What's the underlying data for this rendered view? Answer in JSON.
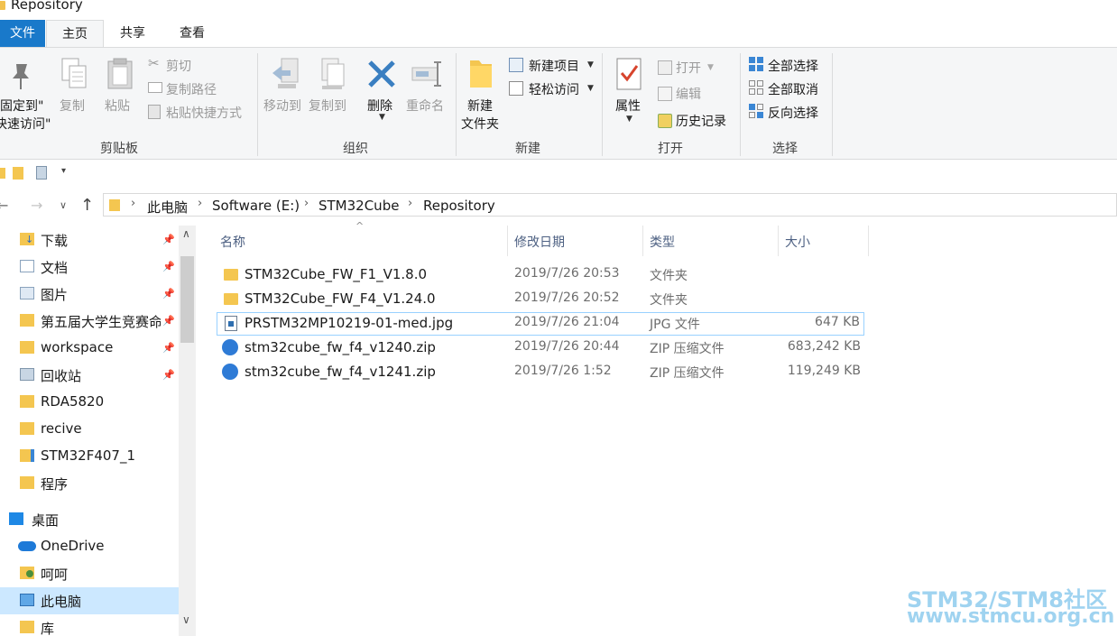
{
  "window": {
    "title": "Repository"
  },
  "ribbon_tabs": [
    "文件",
    "主页",
    "共享",
    "查看"
  ],
  "ribbon": {
    "clipboard": {
      "pin_line1": "固定到\"",
      "pin_line2": "快速访问\"",
      "copy": "复制",
      "paste": "粘贴",
      "cut": "剪切",
      "copy_path": "复制路径",
      "paste_shortcut": "粘贴快捷方式",
      "label": "剪贴板"
    },
    "organize": {
      "move_to": "移动到",
      "copy_to": "复制到",
      "delete": "删除",
      "rename": "重命名",
      "label": "组织"
    },
    "new": {
      "new_folder_line1": "新建",
      "new_folder_line2": "文件夹",
      "new_item": "新建项目",
      "easy_access": "轻松访问",
      "label": "新建"
    },
    "open": {
      "properties": "属性",
      "open": "打开",
      "edit": "编辑",
      "history": "历史记录",
      "label": "打开"
    },
    "select": {
      "select_all": "全部选择",
      "select_none": "全部取消",
      "invert": "反向选择",
      "label": "选择"
    }
  },
  "address": {
    "crumbs": [
      "此电脑",
      "Software (E:)",
      "STM32Cube",
      "Repository"
    ]
  },
  "sidebar": {
    "items": [
      {
        "label": "下载",
        "pinned": true
      },
      {
        "label": "文档",
        "pinned": true
      },
      {
        "label": "图片",
        "pinned": true
      },
      {
        "label": "第五届大学生竞赛命",
        "pinned": true
      },
      {
        "label": "workspace",
        "pinned": true
      },
      {
        "label": "回收站",
        "pinned": true
      },
      {
        "label": "RDA5820",
        "pinned": false
      },
      {
        "label": "recive",
        "pinned": false
      },
      {
        "label": "STM32F407_1",
        "pinned": false
      },
      {
        "label": "程序",
        "pinned": false
      },
      {
        "label": "桌面",
        "pinned": false
      },
      {
        "label": "OneDrive",
        "pinned": false
      },
      {
        "label": "呵呵",
        "pinned": false
      },
      {
        "label": "此电脑",
        "pinned": false
      },
      {
        "label": "库",
        "pinned": false
      }
    ]
  },
  "columns": {
    "name": "名称",
    "modified": "修改日期",
    "type": "类型",
    "size": "大小"
  },
  "files": [
    {
      "name": "STM32Cube_FW_F1_V1.8.0",
      "modified": "2019/7/26 20:53",
      "type": "文件夹",
      "size": "",
      "icon": "folder-icon"
    },
    {
      "name": "STM32Cube_FW_F4_V1.24.0",
      "modified": "2019/7/26 20:52",
      "type": "文件夹",
      "size": "",
      "icon": "folder-icon"
    },
    {
      "name": "PRSTM32MP10219-01-med.jpg",
      "modified": "2019/7/26 21:04",
      "type": "JPG 文件",
      "size": "647 KB",
      "icon": "image-file-icon"
    },
    {
      "name": "stm32cube_fw_f4_v1240.zip",
      "modified": "2019/7/26 20:44",
      "type": "ZIP 压缩文件",
      "size": "683,242 KB",
      "icon": "zip-file-icon"
    },
    {
      "name": "stm32cube_fw_f4_v1241.zip",
      "modified": "2019/7/26 1:52",
      "type": "ZIP 压缩文件",
      "size": "119,249 KB",
      "icon": "zip-file-icon"
    }
  ],
  "watermark": {
    "line1": "STM32/STM8社区",
    "line2": "www.stmcu.org.cn"
  },
  "colors": {
    "accent": "#1979ca",
    "selection_border": "#99d1ff",
    "watermark": "#9fd3f0"
  }
}
